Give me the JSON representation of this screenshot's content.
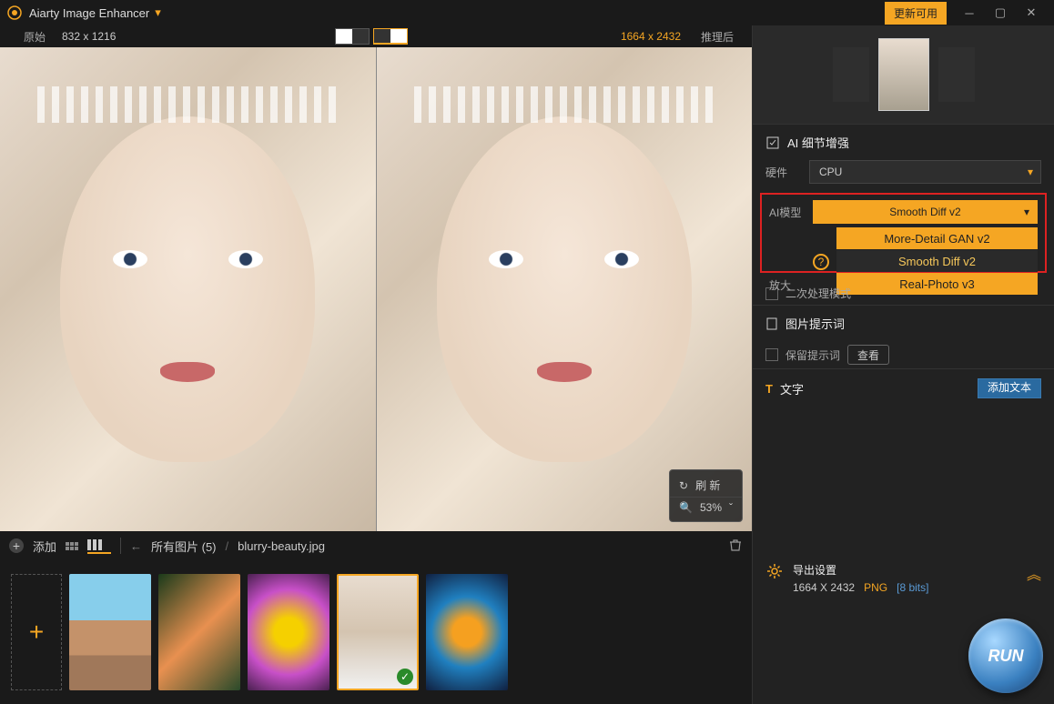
{
  "titlebar": {
    "app_title": "Aiarty Image Enhancer",
    "update_label": "更新可用"
  },
  "dim_bar": {
    "original_label": "原始",
    "original_dim": "832 x 1216",
    "output_dim": "1664 x 2432",
    "after_label": "推理后"
  },
  "float": {
    "refresh_label": "刷 新",
    "zoom_value": "53%"
  },
  "filmstrip_bar": {
    "add_label": "添加",
    "all_images_label": "所有图片 (5)",
    "current_file": "blurry-beauty.jpg"
  },
  "panel": {
    "ai_detail_title": "AI 细节增强",
    "hardware_label": "硬件",
    "hardware_value": "CPU",
    "model_label": "AI模型",
    "model_selected": "Smooth Diff v2",
    "model_options": [
      "More-Detail GAN v2",
      "Smooth Diff v2",
      "Real-Photo v3"
    ],
    "upscale_label": "放大",
    "secondary_mode_label": "二次处理模式",
    "prompt_title": "图片提示词",
    "keep_prompt_label": "保留提示词",
    "view_btn": "查看",
    "text_title": "文字",
    "add_text_btn": "添加文本",
    "export_title": "导出设置",
    "export_dim": "1664 X 2432",
    "export_fmt": "PNG",
    "export_bits": "[8 bits]",
    "run_label": "RUN"
  }
}
